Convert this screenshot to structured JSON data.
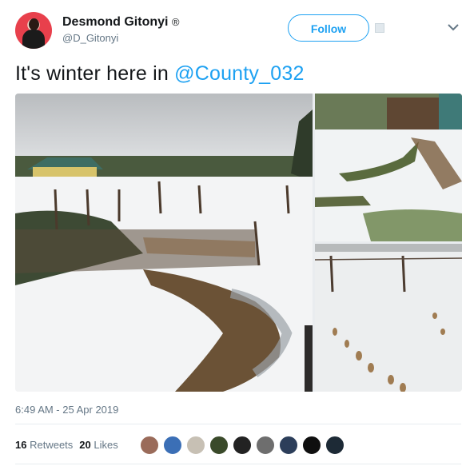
{
  "user": {
    "display_name": "Desmond Gitonyi",
    "verified_mark": "®",
    "handle": "@D_Gitonyi",
    "follow_label": "Follow"
  },
  "tweet": {
    "text": "It's winter here in ",
    "mention": "@County_032",
    "timestamp": "6:49 AM - 25 Apr 2019"
  },
  "stats": {
    "retweets_count": "16",
    "retweets_label": "Retweets",
    "likes_count": "20",
    "likes_label": "Likes"
  },
  "media": {
    "photos": [
      "hail-covered yard with fence",
      "hail-covered garden path",
      "footprints in hail by fence"
    ]
  },
  "likers": [
    "liker-1",
    "liker-2",
    "liker-3",
    "liker-4",
    "liker-5",
    "liker-6",
    "liker-7",
    "liker-8",
    "liker-9"
  ],
  "colors": {
    "accent": "#1da1f2",
    "secondary_text": "#657786",
    "primary_text": "#14171a"
  }
}
